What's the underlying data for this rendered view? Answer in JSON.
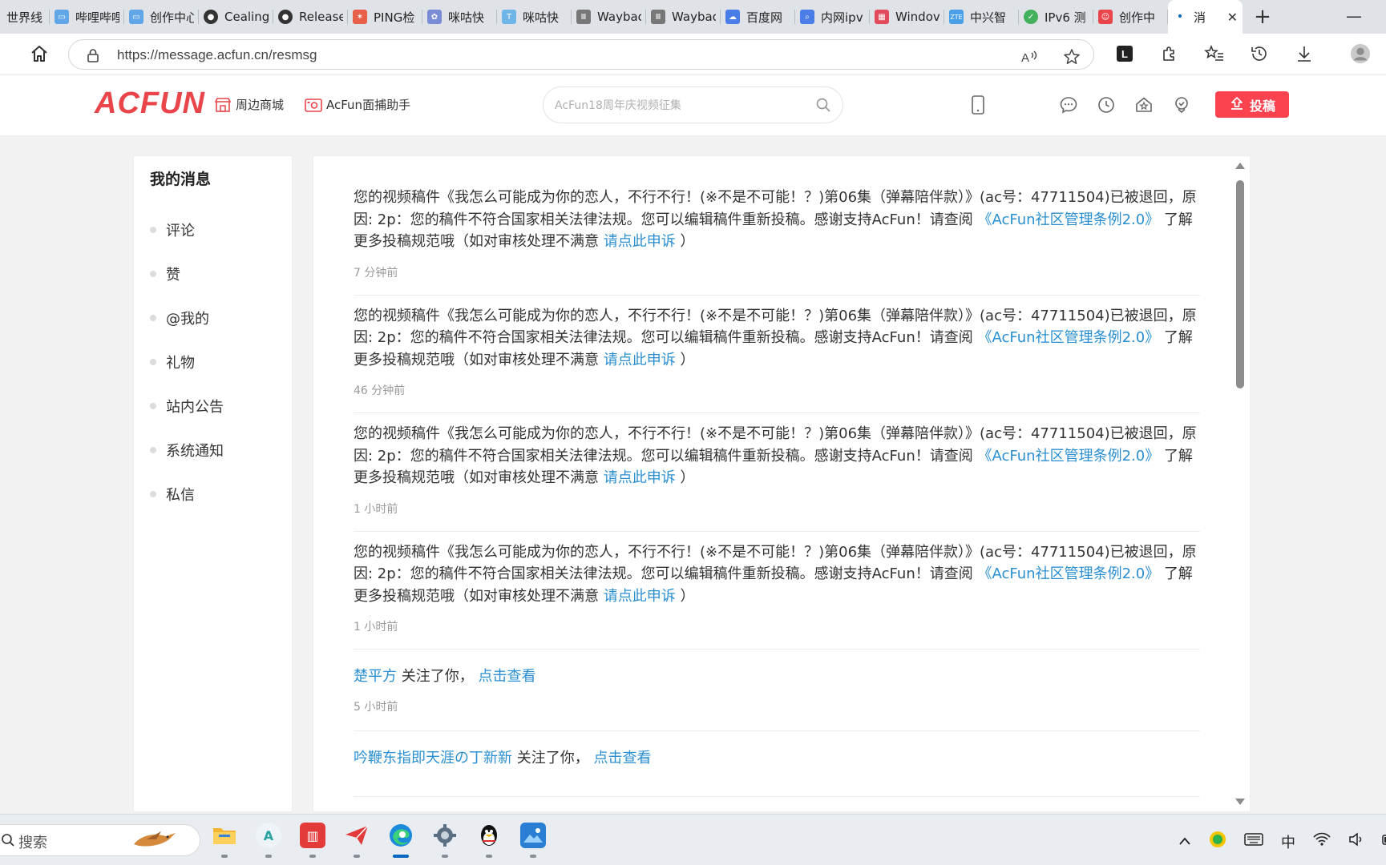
{
  "browser": {
    "tabs": [
      {
        "label": "世界线",
        "color": "#cccccc"
      },
      {
        "label": "哔哩哔哩",
        "color": "#61a7e8"
      },
      {
        "label": "创作中心",
        "color": "#61a7e8"
      },
      {
        "label": "Cealing",
        "color": "#333333"
      },
      {
        "label": "Release",
        "color": "#333333"
      },
      {
        "label": "PING检",
        "color": "#e8604a"
      },
      {
        "label": "咪咕快",
        "color": "#7a8cd6"
      },
      {
        "label": "咪咕快",
        "color": "#6fb5e8"
      },
      {
        "label": "Wayback",
        "color": "#777777"
      },
      {
        "label": "Wayback",
        "color": "#777777"
      },
      {
        "label": "百度网",
        "color": "#4a7de8"
      },
      {
        "label": "内网ipv",
        "color": "#4a7de8"
      },
      {
        "label": "Windov",
        "color": "#e14b5a"
      },
      {
        "label": "中兴智",
        "color": "#4aa0e8"
      },
      {
        "label": "IPv6 测",
        "color": "#43b05c"
      },
      {
        "label": "创作中",
        "color": "#e9454a"
      }
    ],
    "active_tab": {
      "label": "消"
    },
    "url": "https://message.acfun.cn/resmsg"
  },
  "site": {
    "logo": "ACFUN",
    "nav": [
      {
        "label": "周边商城"
      },
      {
        "label": "AcFun面捕助手"
      }
    ],
    "search_placeholder": "AcFun18周年庆视频征集",
    "upload_label": "投稿",
    "brand_color": "#fb4350",
    "link_color": "#2a8fd1"
  },
  "sidebar": {
    "title": "我的消息",
    "items": [
      {
        "label": "评论"
      },
      {
        "label": "赞"
      },
      {
        "label": "@我的"
      },
      {
        "label": "礼物"
      },
      {
        "label": "站内公告"
      },
      {
        "label": "系统通知"
      },
      {
        "label": "私信"
      }
    ]
  },
  "messages": [
    {
      "text": "您的视频稿件《我怎么可能成为你的恋人，不行不行！(※不是不可能！？)第06集（弹幕陪伴款）》(ac号：47711504)已被退回，原因: 2p：您的稿件不符合国家相关法律法规。您可以编辑稿件重新投稿。感谢支持AcFun！请查阅",
      "rules_link": "《AcFun社区管理条例2.0》",
      "after_rules": "了解更多投稿规范哦（如对审核处理不满意",
      "appeal_link": "请点此申诉",
      "close": "）",
      "time": "7 分钟前"
    },
    {
      "text": "您的视频稿件《我怎么可能成为你的恋人，不行不行！(※不是不可能！？)第06集（弹幕陪伴款）》(ac号：47711504)已被退回，原因: 2p：您的稿件不符合国家相关法律法规。您可以编辑稿件重新投稿。感谢支持AcFun！请查阅",
      "rules_link": "《AcFun社区管理条例2.0》",
      "after_rules": "了解更多投稿规范哦（如对审核处理不满意",
      "appeal_link": "请点此申诉",
      "close": "）",
      "time": "46 分钟前"
    },
    {
      "text": "您的视频稿件《我怎么可能成为你的恋人，不行不行！(※不是不可能！？)第06集（弹幕陪伴款）》(ac号：47711504)已被退回，原因: 2p：您的稿件不符合国家相关法律法规。您可以编辑稿件重新投稿。感谢支持AcFun！请查阅",
      "rules_link": "《AcFun社区管理条例2.0》",
      "after_rules": "了解更多投稿规范哦（如对审核处理不满意",
      "appeal_link": "请点此申诉",
      "close": "）",
      "time": "1 小时前"
    },
    {
      "text": "您的视频稿件《我怎么可能成为你的恋人，不行不行！(※不是不可能！？)第06集（弹幕陪伴款）》(ac号：47711504)已被退回，原因: 2p：您的稿件不符合国家相关法律法规。您可以编辑稿件重新投稿。感谢支持AcFun！请查阅",
      "rules_link": "《AcFun社区管理条例2.0》",
      "after_rules": "了解更多投稿规范哦（如对审核处理不满意",
      "appeal_link": "请点此申诉",
      "close": "）",
      "time": "1 小时前"
    }
  ],
  "follows": [
    {
      "user": "楚平方",
      "text": "关注了你，",
      "link": "点击查看",
      "time": "5 小时前"
    },
    {
      "user": "吟鞭东指即天涯の丁新新",
      "text": "关注了你，",
      "link": "点击查看",
      "time": ""
    }
  ],
  "taskbar": {
    "search_label": "搜索",
    "tray_ime": "中"
  }
}
